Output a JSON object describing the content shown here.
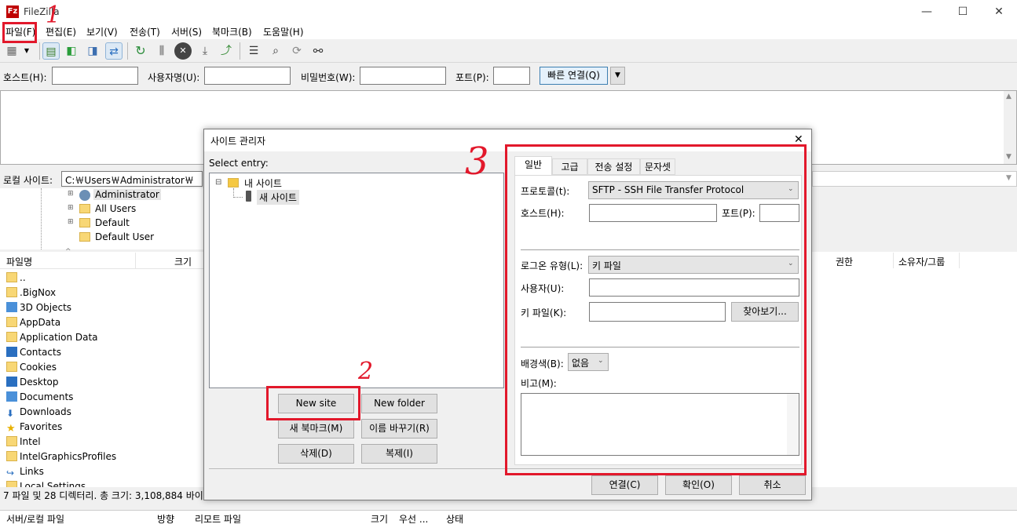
{
  "window": {
    "title": "FileZilla",
    "app_icon": "Fz",
    "minimize": "—",
    "maximize": "☐",
    "close": "✕"
  },
  "menu": [
    "파일(F)",
    "편집(E)",
    "보기(V)",
    "전송(T)",
    "서버(S)",
    "북마크(B)",
    "도움말(H)"
  ],
  "quickconnect": {
    "host_label": "호스트(H):",
    "user_label": "사용자명(U):",
    "pass_label": "비밀번호(W):",
    "port_label": "포트(P):",
    "connect_label": "빠른 연결(Q)",
    "dropdown_icon": "▼"
  },
  "local": {
    "label": "로컬 사이트:",
    "path": "C:￦Users￦Administrator￦",
    "tree": [
      "Administrator",
      "All Users",
      "Default",
      "Default User"
    ],
    "columns": {
      "name": "파일명",
      "size": "크기"
    },
    "files": [
      {
        "name": "..",
        "icon": "folder"
      },
      {
        "name": ".BigNox",
        "icon": "folder"
      },
      {
        "name": "3D Objects",
        "icon": "3d-objects"
      },
      {
        "name": "AppData",
        "icon": "folder"
      },
      {
        "name": "Application Data",
        "icon": "folder"
      },
      {
        "name": "Contacts",
        "icon": "contacts"
      },
      {
        "name": "Cookies",
        "icon": "folder"
      },
      {
        "name": "Desktop",
        "icon": "desktop"
      },
      {
        "name": "Documents",
        "icon": "documents"
      },
      {
        "name": "Downloads",
        "icon": "downloads"
      },
      {
        "name": "Favorites",
        "icon": "star"
      },
      {
        "name": "Intel",
        "icon": "folder"
      },
      {
        "name": "IntelGraphicsProfiles",
        "icon": "folder"
      },
      {
        "name": "Links",
        "icon": "links"
      },
      {
        "name": "Local Settings",
        "icon": "folder"
      }
    ],
    "status": "7 파일 및 28 디렉터리. 총 크기: 3,108,884 바이"
  },
  "remote": {
    "columns": {
      "perms": "권한",
      "owner": "소유자/그룹"
    }
  },
  "queue": {
    "columns": [
      "서버/로컬 파일",
      "방향",
      "리모트 파일",
      "크기",
      "우선 ...",
      "상태"
    ]
  },
  "dialog": {
    "title": "사이트 관리자",
    "close": "✕",
    "select_entry": "Select entry:",
    "tree": {
      "root": "내 사이트",
      "child": "새 사이트"
    },
    "buttons": {
      "new_site": "New site",
      "new_folder": "New folder",
      "new_bookmark": "새 북마크(M)",
      "rename": "이름 바꾸기(R)",
      "delete": "삭제(D)",
      "duplicate": "복제(I)",
      "connect": "연결(C)",
      "ok": "확인(O)",
      "cancel": "취소"
    },
    "tabs": [
      "일반",
      "고급",
      "전송 설정",
      "문자셋"
    ],
    "general": {
      "protocol_label": "프로토콜(t):",
      "protocol_value": "SFTP - SSH File Transfer Protocol",
      "host_label": "호스트(H):",
      "port_label": "포트(P):",
      "logon_label": "로그온 유형(L):",
      "logon_value": "키 파일",
      "user_label": "사용자(U):",
      "keyfile_label": "키 파일(K):",
      "browse_label": "찾아보기...",
      "bgcolor_label": "배경색(B):",
      "bgcolor_value": "없음",
      "comments_label": "비고(M):"
    }
  },
  "annotations": {
    "n1": "1",
    "n2": "2",
    "n3": "3",
    "color": "#e2182b"
  }
}
